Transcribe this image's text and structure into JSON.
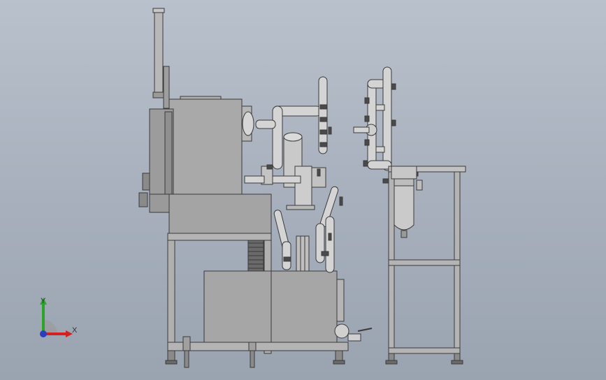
{
  "viewport": {
    "background_top": "#b9c1cc",
    "background_bottom": "#9aa3b0"
  },
  "model": {
    "body_color": "#a7a7a7",
    "edge_color": "#3a3a3a",
    "pipe_color": "#d4d4d4",
    "valve_color": "#4a4a4a"
  },
  "triad": {
    "y_label": "Y",
    "x_label": "X",
    "y_color": "#2aa52a",
    "x_color": "#d42020",
    "z_color": "#2a3fbf"
  }
}
